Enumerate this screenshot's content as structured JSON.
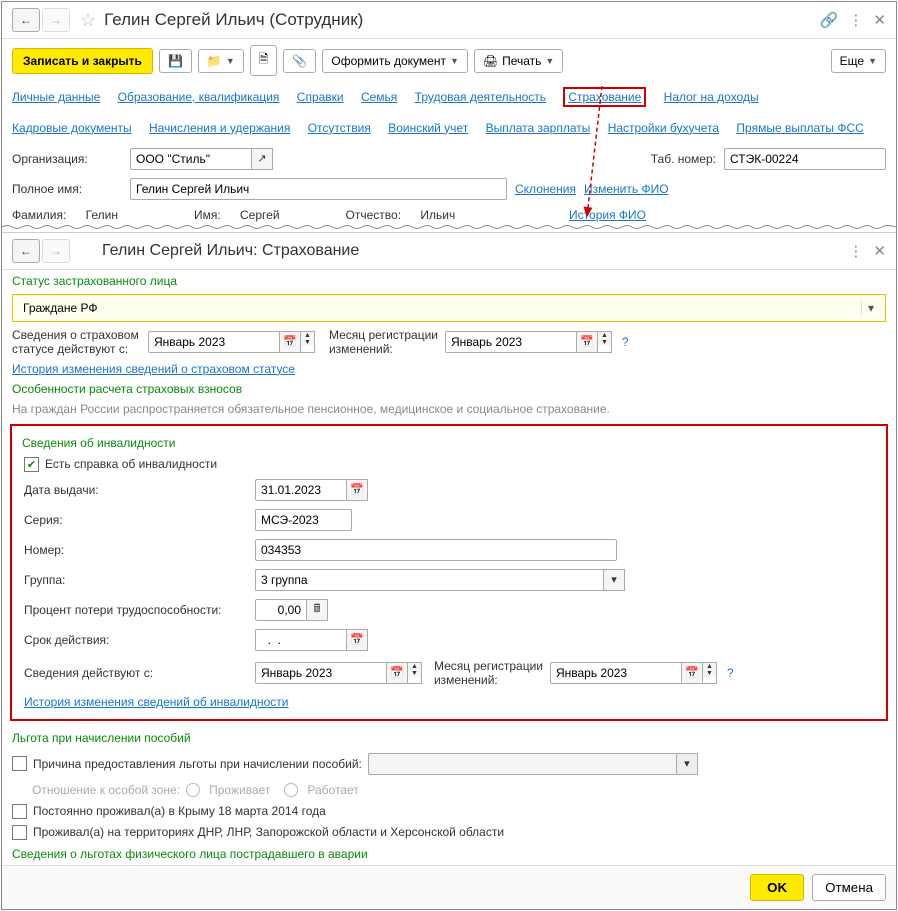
{
  "win1": {
    "title": "Гелин Сергей Ильич (Сотрудник)",
    "toolbar": {
      "save_close": "Записать и закрыть",
      "doc_menu": "Оформить документ",
      "print": "Печать",
      "more": "Еще"
    },
    "links_row1": [
      "Личные данные",
      "Образование, квалификация",
      "Справки",
      "Семья",
      "Трудовая деятельность",
      "Страхование",
      "Налог на доходы"
    ],
    "links_row2": [
      "Кадровые документы",
      "Начисления и удержания",
      "Отсутствия",
      "Воинский учет",
      "Выплата зарплаты",
      "Настройки бухучета",
      "Прямые выплаты ФСС"
    ],
    "labels": {
      "org": "Организация:",
      "tab_no": "Таб. номер:",
      "full_name": "Полное имя:",
      "declensions": "Склонения",
      "edit_fio": "Изменить ФИО",
      "surname": "Фамилия:",
      "name": "Имя:",
      "patronymic": "Отчество:",
      "fio_history": "История ФИО"
    },
    "values": {
      "org": "ООО \"Стиль\"",
      "tab_no": "СТЭК-00224",
      "full_name": "Гелин Сергей Ильич",
      "surname": "Гелин",
      "name": "Сергей",
      "patronymic": "Ильич"
    }
  },
  "win2": {
    "title": "Гелин Сергей Ильич: Страхование",
    "sections": {
      "status_header": "Статус застрахованного лица",
      "status_value": "Граждане РФ",
      "valid_from_label": "Сведения о страховом статусе действуют с:",
      "valid_from": "Январь 2023",
      "reg_month_label": "Месяц регистрации изменений:",
      "reg_month": "Январь 2023",
      "status_history_link": "История изменения сведений о страховом статусе",
      "calc_header": "Особенности расчета страховых взносов",
      "calc_note": "На граждан России распространяется обязательное пенсионное, медицинское и социальное страхование.",
      "disability_header": "Сведения об инвалидности",
      "has_cert": "Есть справка об инвалидности",
      "issue_date_label": "Дата выдачи:",
      "issue_date": "31.01.2023",
      "series_label": "Серия:",
      "series": "МСЭ-2023",
      "number_label": "Номер:",
      "number": "034353",
      "group_label": "Группа:",
      "group": "3 группа",
      "percent_label": "Процент потери трудоспособности:",
      "percent": "0,00",
      "validity_label": "Срок действия:",
      "validity": "  .  .    ",
      "info_valid_from_label": "Сведения действуют с:",
      "info_valid_from": "Январь 2023",
      "info_reg_month_label": "Месяц регистрации изменений:",
      "info_reg_month": "Январь 2023",
      "disability_history_link": "История изменения сведений об инвалидности",
      "benefit_header": "Льгота при начислении пособий",
      "benefit_reason_label": "Причина предоставления льготы при начислении пособий:",
      "zone_label": "Отношение к особой зоне:",
      "zone_live": "Проживает",
      "zone_work": "Работает",
      "crimea": "Постоянно проживал(а) в Крыму 18 марта 2014 года",
      "dnr": "Проживал(а) на территориях ДНР, ЛНР, Запорожской области и Херсонской области",
      "accident_header": "Сведения о льготах физического лица пострадавшего в аварии"
    },
    "buttons": {
      "ok": "OK",
      "cancel": "Отмена"
    }
  }
}
